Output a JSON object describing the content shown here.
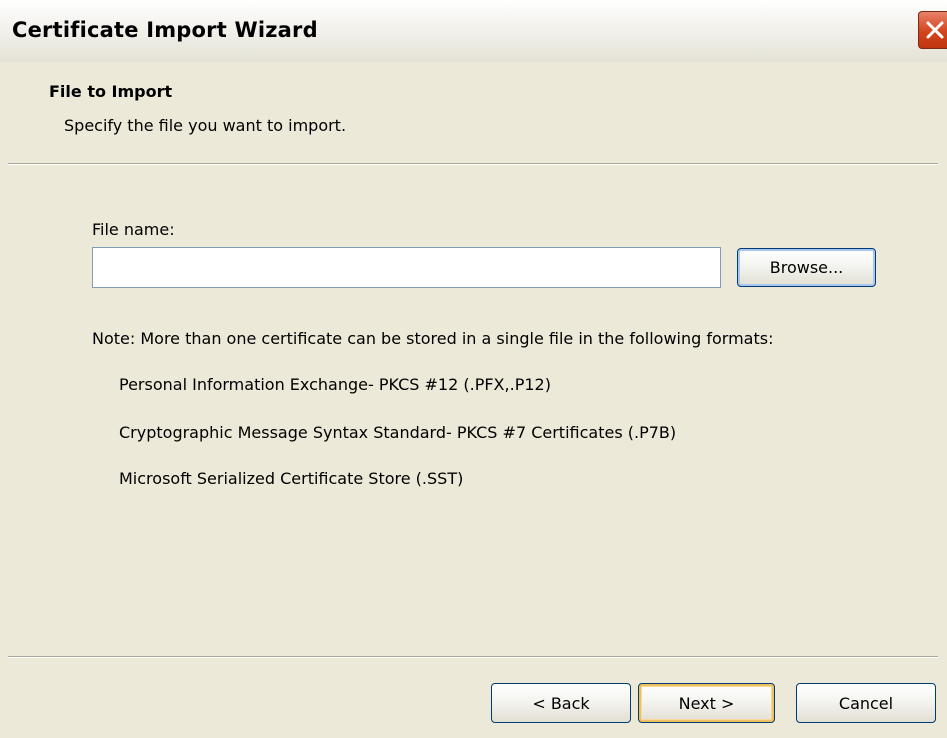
{
  "window": {
    "title": "Certificate Import Wizard"
  },
  "header": {
    "title": "File to Import",
    "subtitle": "Specify the file you want to import."
  },
  "form": {
    "file_label": "File name:",
    "file_value": "",
    "browse_label": "Browse..."
  },
  "note": {
    "text": "Note:  More than one certificate can be stored in a single file in the following formats:",
    "formats": [
      "Personal Information Exchange- PKCS #12 (.PFX,.P12)",
      "Cryptographic Message Syntax Standard- PKCS #7 Certificates (.P7B)",
      "Microsoft Serialized Certificate Store (.SST)"
    ]
  },
  "footer": {
    "back_label": "< Back",
    "next_label": "Next >",
    "cancel_label": "Cancel"
  },
  "colors": {
    "window_bg": "#ece9d8",
    "close_button": "#d2451c",
    "button_border": "#003c74",
    "default_button_highlight": "#f0c060",
    "input_border": "#7f9db9"
  }
}
